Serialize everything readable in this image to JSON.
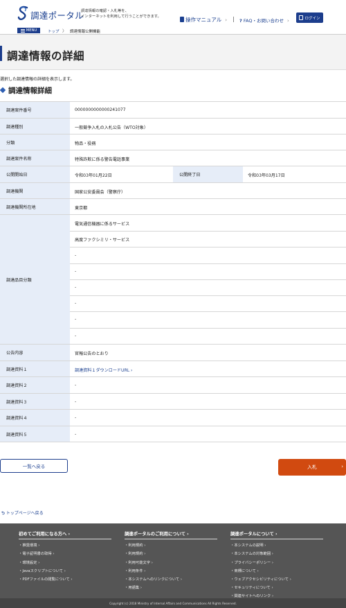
{
  "header": {
    "logo_text": "調達ポータル",
    "tagline_line1": "調達情報の確認・入札等を、",
    "tagline_line2": "インターネットを利用して行うことができます。",
    "manual_label": "操作マニュアル",
    "faq_label": "FAQ・お問い合わせ",
    "login_label": "ログイン"
  },
  "menubar": {
    "menu_label": "MENU",
    "breadcrumb_home": "トップ",
    "breadcrumb_sep": "〉",
    "breadcrumb_current": "調達情報公開機能"
  },
  "page": {
    "title": "調達情報の詳細",
    "description": "選択した調達情報の詳細を表示します。",
    "section_title": "調達情報詳細"
  },
  "details": {
    "case_number_label": "調達案件番号",
    "case_number": "0000000000000241077",
    "type_label": "調達種別",
    "type": "一般競争入札の入札公告（WTO対象）",
    "category_label": "分類",
    "category": "物品・役務",
    "name_label": "調達案件名称",
    "name": "特殊詐欺に係る警告電話事業",
    "start_label": "公開開始日",
    "start": "令和03年01月22日",
    "end_label": "公開終了日",
    "end": "令和03年03月17日",
    "agency_label": "調達機関",
    "agency": "国家公安委員会（警察庁）",
    "location_label": "調達機関所在地",
    "location": "東京都",
    "item_class_label": "調達品目分類",
    "item_classes": [
      "電気通信機器に係るサービス",
      "高度ファクシミリ・サービス",
      "-",
      "-",
      "-",
      "-",
      "-",
      "-"
    ],
    "notice_label": "公告内容",
    "notice": "官報公告のとおり",
    "doc1_label": "調達資料１",
    "doc1": "調達資料１ダウンロードURL",
    "doc2_label": "調達資料２",
    "doc2": "-",
    "doc3_label": "調達資料３",
    "doc3": "-",
    "doc4_label": "調達資料４",
    "doc4": "-",
    "doc5_label": "調達資料５",
    "doc5": "-"
  },
  "actions": {
    "back_label": "一覧へ戻る",
    "bid_label": "入札",
    "top_link": "トップページへ戻る"
  },
  "footer": {
    "col1": {
      "heading": "初めてご利用になる方へ",
      "items": [
        "推奨環境",
        "電子証明書の取得",
        "環境設定",
        "Javaスクリプトについて",
        "PDFファイルの閲覧について"
      ]
    },
    "col2": {
      "heading": "調達ポータルのご利用について",
      "items": [
        "利用規約",
        "利用規約",
        "利用可能文字",
        "利用条件",
        "本システムへのリンクについて",
        "用語集"
      ]
    },
    "col3": {
      "heading": "調達ポータルについて",
      "items": [
        "本システムの説明",
        "本システムの対象範囲",
        "プライバシーポリシー",
        "商標について",
        "ウェブアクセシビリティについて",
        "セキュリティについて",
        "関連サイトへのリンク"
      ]
    },
    "copyright": "Copyright (c) 2018 Ministry of Internal Affairs and Communications All Rights Reserved."
  },
  "colors": {
    "brand": "#1c3d8c",
    "label_bg": "#e6edf8",
    "bid_button": "#d14a10",
    "footer_bg": "#555555"
  }
}
